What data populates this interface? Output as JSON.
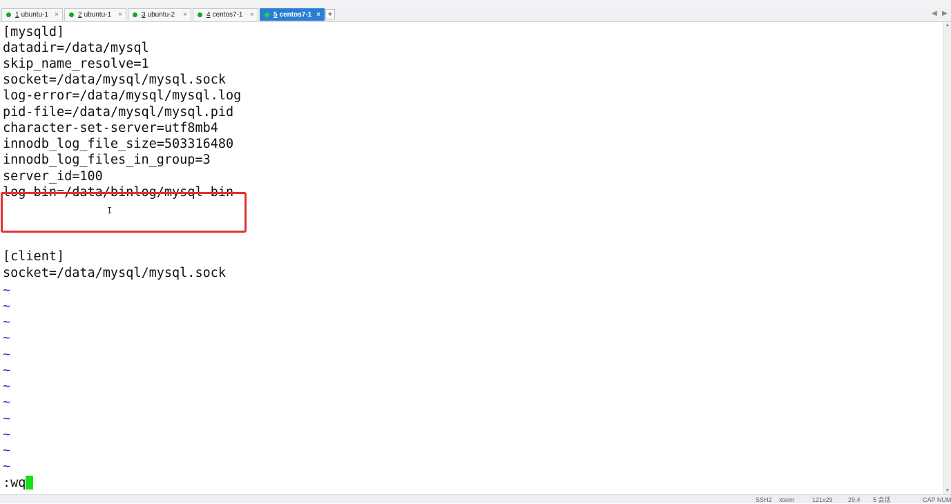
{
  "tabs": [
    {
      "number": "1",
      "label": "ubuntu-1",
      "dot_color": "#1aa81a"
    },
    {
      "number": "2",
      "label": "ubuntu-1",
      "dot_color": "#1aa81a"
    },
    {
      "number": "3",
      "label": "ubuntu-2",
      "dot_color": "#1aa81a"
    },
    {
      "number": "4",
      "label": "centos7-1",
      "dot_color": "#1aa81a"
    },
    {
      "number": "5",
      "label": "centos7-1",
      "dot_color": "#2ecf3a",
      "active": true
    }
  ],
  "new_tab_label": "+",
  "close_glyph": "×",
  "terminal": {
    "lines": [
      "[mysqld]",
      "datadir=/data/mysql",
      "skip_name_resolve=1",
      "socket=/data/mysql/mysql.sock",
      "log-error=/data/mysql/mysql.log",
      "pid-file=/data/mysql/mysql.pid",
      "character-set-server=utf8mb4",
      "innodb_log_file_size=503316480",
      "innodb_log_files_in_group=3",
      "server_id=100",
      "log-bin=/data/binlog/mysql-bin",
      "",
      "",
      "[client]",
      "socket=/data/mysql/mysql.sock"
    ],
    "tilde": "~",
    "tilde_count": 12,
    "command": ":wq",
    "highlight_color": "#e53030",
    "cursor_color": "#16e016"
  },
  "statusbar": {
    "items": [
      "SSH2",
      "xterm",
      "121x29",
      "29,4",
      "5 会话",
      "CAP NUM"
    ]
  }
}
